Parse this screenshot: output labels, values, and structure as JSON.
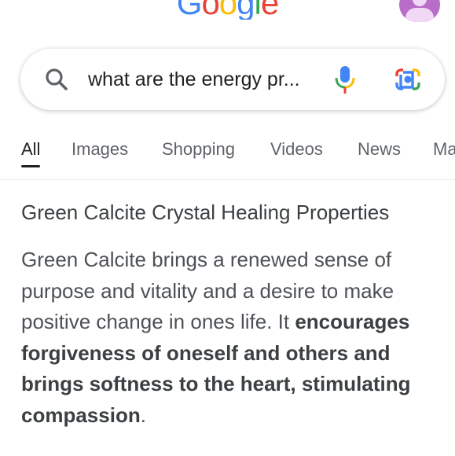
{
  "header": {
    "logo_letters": [
      {
        "ch": "G",
        "color": "#4285F4"
      },
      {
        "ch": "o",
        "color": "#EA4335"
      },
      {
        "ch": "o",
        "color": "#FBBC05"
      },
      {
        "ch": "g",
        "color": "#4285F4"
      },
      {
        "ch": "l",
        "color": "#34A853"
      },
      {
        "ch": "e",
        "color": "#EA4335"
      }
    ],
    "avatar_color": "#b86dc8"
  },
  "search": {
    "query": "what are the energy pr...",
    "search_icon": "search-icon",
    "mic_icon": "microphone-icon",
    "lens_icon": "google-lens-icon"
  },
  "tabs": [
    {
      "label": "All",
      "active": true
    },
    {
      "label": "Images",
      "active": false
    },
    {
      "label": "Shopping",
      "active": false
    },
    {
      "label": "Videos",
      "active": false
    },
    {
      "label": "News",
      "active": false
    },
    {
      "label": "Ma",
      "active": false
    }
  ],
  "result": {
    "title": "Green Calcite Crystal Healing Properties",
    "snippet_plain": "Green Calcite brings a renewed sense of purpose and vitality and a desire to make positive change in ones life. It ",
    "snippet_bold": "encourages forgiveness of oneself and others and brings softness to the heart, stimulating compassion",
    "snippet_end": "."
  }
}
